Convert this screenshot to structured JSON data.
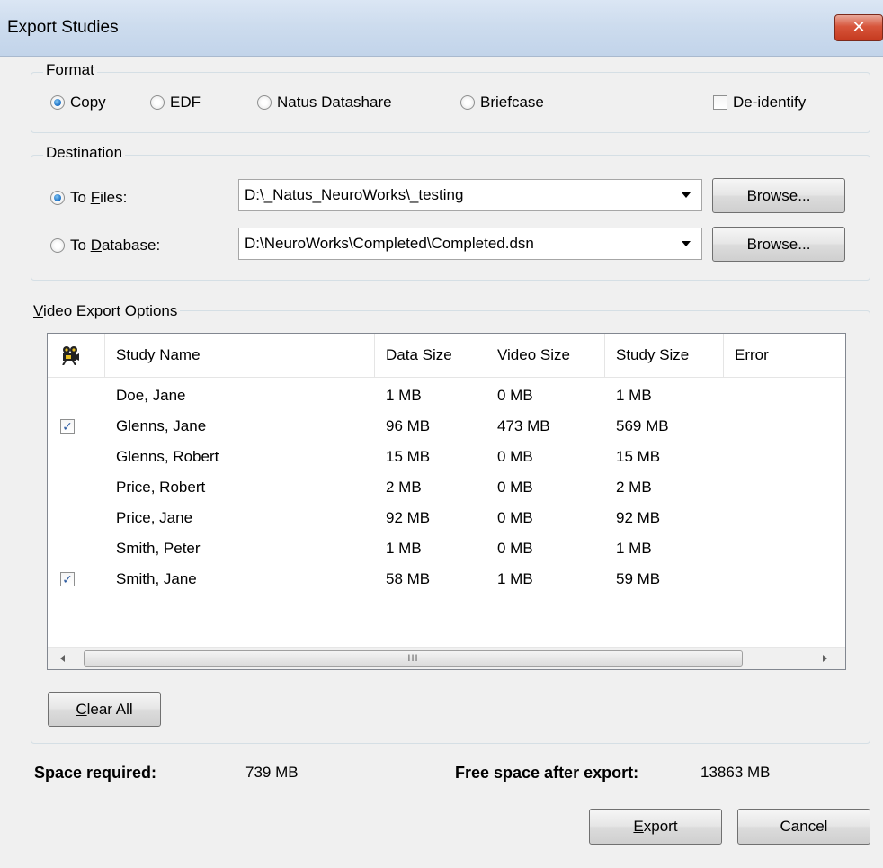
{
  "window": {
    "title": "Export Studies",
    "close_label": "✕"
  },
  "format": {
    "legend": "Format",
    "options": [
      {
        "label": "Copy",
        "selected": true
      },
      {
        "label": "EDF",
        "selected": false
      },
      {
        "label": "Natus Datashare",
        "selected": false
      },
      {
        "label": "Briefcase",
        "selected": false
      }
    ],
    "deidentify": {
      "label": "De-identify",
      "checked": false
    }
  },
  "destination": {
    "legend": "Destination",
    "to_files": {
      "prefix": "To ",
      "underline": "F",
      "suffix": "iles:",
      "selected": true,
      "value": "D:\\_Natus_NeuroWorks\\_testing",
      "browse_label": "Browse..."
    },
    "to_database": {
      "prefix": "To ",
      "underline": "D",
      "suffix": "atabase:",
      "selected": false,
      "value": "D:\\NeuroWorks\\Completed\\Completed.dsn",
      "browse_label": "Browse..."
    }
  },
  "video_export": {
    "legend_underline": "V",
    "legend_rest": "ideo Export Options",
    "columns": [
      "Study Name",
      "Data Size",
      "Video Size",
      "Study Size",
      "Error"
    ],
    "header_icon": "video-camera-icon",
    "rows": [
      {
        "checked": false,
        "name": "Doe, Jane",
        "data_size": "1 MB",
        "video_size": "0 MB",
        "study_size": "1 MB",
        "error": ""
      },
      {
        "checked": true,
        "name": "Glenns, Jane",
        "data_size": "96 MB",
        "video_size": "473 MB",
        "study_size": "569 MB",
        "error": ""
      },
      {
        "checked": false,
        "name": "Glenns, Robert",
        "data_size": "15 MB",
        "video_size": "0 MB",
        "study_size": "15 MB",
        "error": ""
      },
      {
        "checked": false,
        "name": "Price, Robert",
        "data_size": "2 MB",
        "video_size": "0 MB",
        "study_size": "2 MB",
        "error": ""
      },
      {
        "checked": false,
        "name": "Price, Jane",
        "data_size": "92 MB",
        "video_size": "0 MB",
        "study_size": "92 MB",
        "error": ""
      },
      {
        "checked": false,
        "name": "Smith, Peter",
        "data_size": "1 MB",
        "video_size": "0 MB",
        "study_size": "1 MB",
        "error": ""
      },
      {
        "checked": true,
        "name": "Smith, Jane",
        "data_size": "58 MB",
        "video_size": "1 MB",
        "study_size": "59 MB",
        "error": ""
      }
    ],
    "scroll_grip": "III",
    "clear_all": {
      "underline": "C",
      "rest": "lear All"
    }
  },
  "summary": {
    "space_required_label": "Space required:",
    "space_required_value": "739 MB",
    "free_space_label": "Free space after export:",
    "free_space_value": "13863 MB"
  },
  "actions": {
    "export": {
      "underline": "E",
      "rest": "xport"
    },
    "cancel": "Cancel"
  },
  "colors": {
    "title_bar": "#cddcee",
    "close_button": "#c53a1f",
    "radio_selected": "#1b6fc4"
  }
}
